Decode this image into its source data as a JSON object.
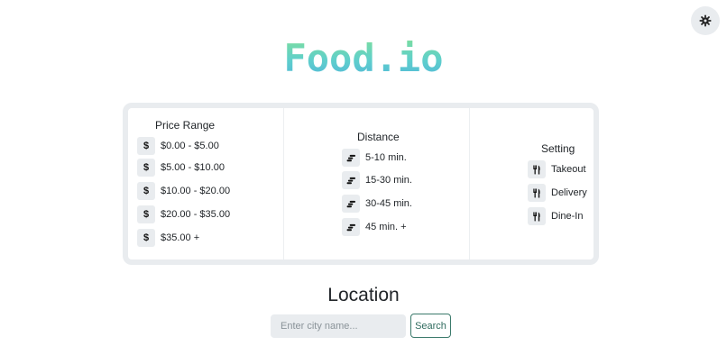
{
  "app": {
    "title": "Food.io"
  },
  "filters": {
    "price": {
      "title": "Price Range",
      "icon": "dollar-icon",
      "options": [
        "$0.00 - $5.00",
        "$5.00 - $10.00",
        "$10.00 - $20.00",
        "$20.00 - $35.00",
        "$35.00 +"
      ]
    },
    "distance": {
      "title": "Distance",
      "icon": "running-icon",
      "options": [
        "5-10 min.",
        "15-30 min.",
        "30-45 min.",
        "45 min. +"
      ]
    },
    "setting": {
      "title": "Setting",
      "icon": "utensils-icon",
      "options": [
        "Takeout",
        "Delivery",
        "Dine-In"
      ]
    }
  },
  "location": {
    "title": "Location",
    "placeholder": "Enter city name...",
    "value": "",
    "search_label": "Search"
  },
  "settings_button": {
    "icon": "gear-icon"
  },
  "colors": {
    "logo_gradient_top": "#7fdf9a",
    "logo_gradient_bottom": "#52b6d9",
    "icon_box": "#e9ecef",
    "button_border": "#3b7a6b"
  }
}
